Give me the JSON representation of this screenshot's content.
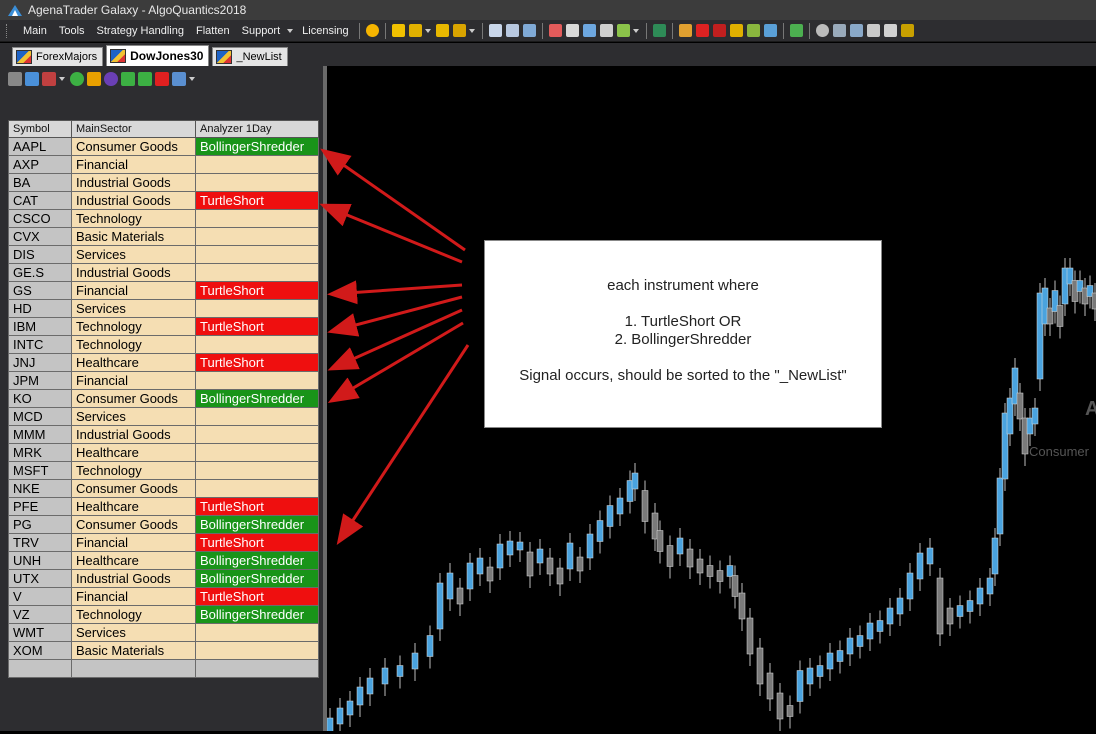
{
  "window": {
    "title": "AgenaTrader Galaxy - AlgoQuantics2018"
  },
  "menubar": {
    "items": [
      "Main",
      "Tools",
      "Strategy Handling",
      "Flatten",
      "Support",
      "Licensing"
    ]
  },
  "tabs": [
    {
      "label": "ForexMajors",
      "active": false
    },
    {
      "label": "DowJones30",
      "active": true
    },
    {
      "label": "_NewList",
      "active": false
    }
  ],
  "grid": {
    "columns": [
      "Symbol",
      "MainSector",
      "Analyzer 1Day"
    ],
    "rows": [
      {
        "symbol": "AAPL",
        "sector": "Consumer Goods",
        "analyzer": "BollingerShredder"
      },
      {
        "symbol": "AXP",
        "sector": "Financial",
        "analyzer": ""
      },
      {
        "symbol": "BA",
        "sector": "Industrial Goods",
        "analyzer": ""
      },
      {
        "symbol": "CAT",
        "sector": "Industrial Goods",
        "analyzer": "TurtleShort"
      },
      {
        "symbol": "CSCO",
        "sector": "Technology",
        "analyzer": ""
      },
      {
        "symbol": "CVX",
        "sector": "Basic Materials",
        "analyzer": ""
      },
      {
        "symbol": "DIS",
        "sector": "Services",
        "analyzer": ""
      },
      {
        "symbol": "GE.S",
        "sector": "Industrial Goods",
        "analyzer": ""
      },
      {
        "symbol": "GS",
        "sector": "Financial",
        "analyzer": "TurtleShort"
      },
      {
        "symbol": "HD",
        "sector": "Services",
        "analyzer": ""
      },
      {
        "symbol": "IBM",
        "sector": "Technology",
        "analyzer": "TurtleShort"
      },
      {
        "symbol": "INTC",
        "sector": "Technology",
        "analyzer": ""
      },
      {
        "symbol": "JNJ",
        "sector": "Healthcare",
        "analyzer": "TurtleShort"
      },
      {
        "symbol": "JPM",
        "sector": "Financial",
        "analyzer": ""
      },
      {
        "symbol": "KO",
        "sector": "Consumer Goods",
        "analyzer": "BollingerShredder"
      },
      {
        "symbol": "MCD",
        "sector": "Services",
        "analyzer": ""
      },
      {
        "symbol": "MMM",
        "sector": "Industrial Goods",
        "analyzer": ""
      },
      {
        "symbol": "MRK",
        "sector": "Healthcare",
        "analyzer": ""
      },
      {
        "symbol": "MSFT",
        "sector": "Technology",
        "analyzer": ""
      },
      {
        "symbol": "NKE",
        "sector": "Consumer Goods",
        "analyzer": ""
      },
      {
        "symbol": "PFE",
        "sector": "Healthcare",
        "analyzer": "TurtleShort"
      },
      {
        "symbol": "PG",
        "sector": "Consumer Goods",
        "analyzer": "BollingerShredder"
      },
      {
        "symbol": "TRV",
        "sector": "Financial",
        "analyzer": "TurtleShort"
      },
      {
        "symbol": "UNH",
        "sector": "Healthcare",
        "analyzer": "BollingerShredder"
      },
      {
        "symbol": "UTX",
        "sector": "Industrial Goods",
        "analyzer": "BollingerShredder"
      },
      {
        "symbol": "V",
        "sector": "Financial",
        "analyzer": "TurtleShort"
      },
      {
        "symbol": "VZ",
        "sector": "Technology",
        "analyzer": "BollingerShredder"
      },
      {
        "symbol": "WMT",
        "sector": "Services",
        "analyzer": ""
      },
      {
        "symbol": "XOM",
        "sector": "Basic Materials",
        "analyzer": ""
      }
    ]
  },
  "callout": {
    "line1": "each instrument where",
    "line2": "1. TurtleShort OR",
    "line3": "2. BollingerShredder",
    "line4": "Signal occurs, should be sorted to the \"_NewList\""
  },
  "chart": {
    "watermark_letter": "A",
    "watermark_sector": "Consumer"
  },
  "colors": {
    "turtle_short": "#ef0f0f",
    "bollinger_shredder": "#199419",
    "arrow": "#d11a1a",
    "candle_up": "#4aa3df",
    "candle_down": "#7a7a7a"
  }
}
